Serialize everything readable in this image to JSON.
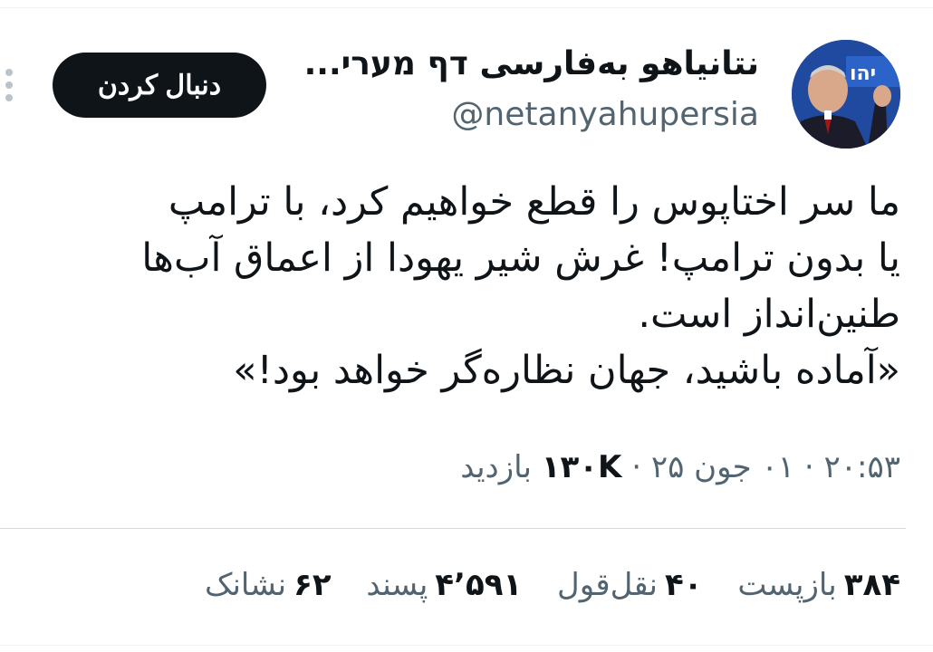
{
  "tweet": {
    "author": {
      "display_name": "نتانیاهو به‌فارسی דף מערי...",
      "handle": "@netanyahupersia",
      "avatar_icon": "profile-photo"
    },
    "follow_label": "دنبال کردن",
    "more_icon": "more-vertical-icon",
    "text_lines": [
      "ما سر اختاپوس را قطع خواهیم کرد، با ترامپ",
      "یا بدون ترامپ! غرش شیر یهودا از اعماق آب‌ها",
      "طنین‌انداز است.",
      "«آماده باشید، جهان نظاره‌گر خواهد بود!»"
    ],
    "meta": {
      "time": "۲۰:۵۳",
      "date": "۰۱ جون ۲۵",
      "separator": "·",
      "views_count": "۱۳۰K",
      "views_label": "بازدید"
    },
    "stats": {
      "reposts": {
        "count": "۳۸۴",
        "label": "بازپست"
      },
      "quotes": {
        "count": "۴۰",
        "label": "نقل‌قول"
      },
      "likes": {
        "count": "۴٬۵۹۱",
        "label": "پسند"
      },
      "bookmarks": {
        "count": "۶۲",
        "label": "نشانک"
      }
    }
  }
}
